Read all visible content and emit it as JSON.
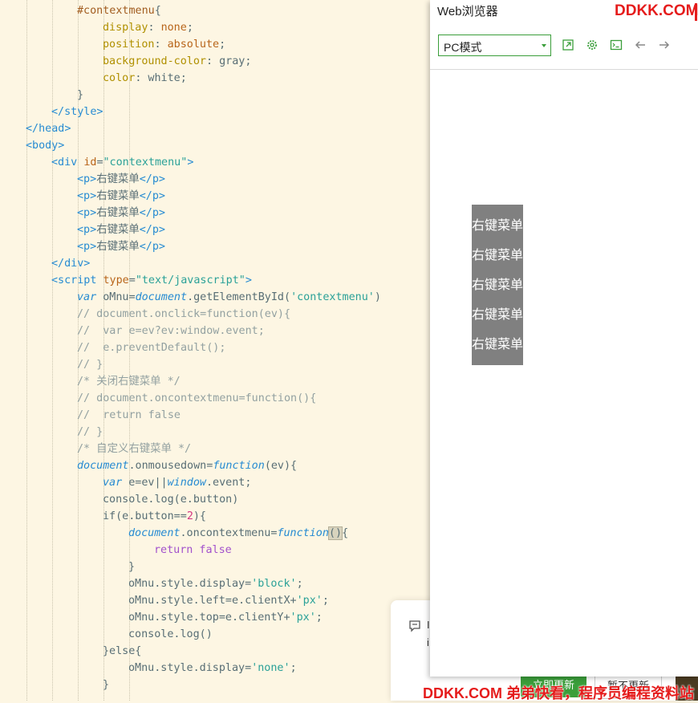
{
  "code": {
    "lines": [
      [
        [
          "tok-sel",
          "#contextmenu"
        ],
        [
          "tok-plain",
          "{"
        ]
      ],
      [
        [
          "tok-prop",
          "display"
        ],
        [
          "tok-plain",
          ": "
        ],
        [
          "tok-val",
          "none"
        ],
        [
          "tok-plain",
          ";"
        ]
      ],
      [
        [
          "tok-prop",
          "position"
        ],
        [
          "tok-plain",
          ": "
        ],
        [
          "tok-val",
          "absolute"
        ],
        [
          "tok-plain",
          ";"
        ]
      ],
      [
        [
          "tok-prop",
          "background-color"
        ],
        [
          "tok-plain",
          ": gray;"
        ]
      ],
      [
        [
          "tok-prop",
          "color"
        ],
        [
          "tok-plain",
          ": white;"
        ]
      ],
      [
        [
          "tok-plain",
          "}"
        ]
      ],
      [
        [
          "tok-tag",
          "</style>"
        ]
      ],
      [
        [
          "tok-tag",
          "</head>"
        ]
      ],
      [
        [
          "tok-tag",
          "<body>"
        ]
      ],
      [
        [
          "tok-tag",
          "<div "
        ],
        [
          "tok-attr",
          "id"
        ],
        [
          "tok-plain",
          "="
        ],
        [
          "tok-str",
          "\"contextmenu\""
        ],
        [
          "tok-tag",
          ">"
        ]
      ],
      [
        [
          "tok-tag",
          "<p>"
        ],
        [
          "tok-plain",
          "右键菜单"
        ],
        [
          "tok-tag",
          "</p>"
        ]
      ],
      [
        [
          "tok-tag",
          "<p>"
        ],
        [
          "tok-plain",
          "右键菜单"
        ],
        [
          "tok-tag",
          "</p>"
        ]
      ],
      [
        [
          "tok-tag",
          "<p>"
        ],
        [
          "tok-plain",
          "右键菜单"
        ],
        [
          "tok-tag",
          "</p>"
        ]
      ],
      [
        [
          "tok-tag",
          "<p>"
        ],
        [
          "tok-plain",
          "右键菜单"
        ],
        [
          "tok-tag",
          "</p>"
        ]
      ],
      [
        [
          "tok-tag",
          "<p>"
        ],
        [
          "tok-plain",
          "右键菜单"
        ],
        [
          "tok-tag",
          "</p>"
        ]
      ],
      [
        [
          "tok-tag",
          "</div>"
        ]
      ],
      [
        [
          "tok-tag",
          "<script "
        ],
        [
          "tok-attr",
          "type"
        ],
        [
          "tok-plain",
          "="
        ],
        [
          "tok-str",
          "\"text/javascript\""
        ],
        [
          "tok-tag",
          ">"
        ]
      ],
      [
        [
          "tok-kw",
          "var "
        ],
        [
          "tok-plain",
          "oMnu="
        ],
        [
          "tok-obj",
          "document"
        ],
        [
          "tok-plain",
          ".getElementById("
        ],
        [
          "tok-str",
          "'contextmenu'"
        ],
        [
          "tok-plain",
          ")"
        ]
      ],
      [
        [
          "tok-com",
          "// document.onclick=function(ev){"
        ]
      ],
      [
        [
          "tok-com",
          "//  var e=ev?ev:window.event;"
        ]
      ],
      [
        [
          "tok-com",
          "//  e.preventDefault();"
        ]
      ],
      [
        [
          "tok-com",
          "// }"
        ]
      ],
      [
        [
          "tok-com",
          "/* 关闭右键菜单 */"
        ]
      ],
      [
        [
          "tok-com",
          "// document.oncontextmenu=function(){"
        ]
      ],
      [
        [
          "tok-com",
          "//  return false"
        ]
      ],
      [
        [
          "tok-com",
          "// }"
        ]
      ],
      [
        [
          "tok-com",
          "/* 自定义右键菜单 */"
        ]
      ],
      [
        [
          "tok-obj",
          "document"
        ],
        [
          "tok-plain",
          ".onmousedown="
        ],
        [
          "tok-kw",
          "function"
        ],
        [
          "tok-plain",
          "(ev){"
        ]
      ],
      [
        [
          "tok-kw",
          "var "
        ],
        [
          "tok-plain",
          "e=ev||"
        ],
        [
          "tok-obj",
          "window"
        ],
        [
          "tok-plain",
          ".event;"
        ]
      ],
      [
        [
          "tok-plain",
          "console.log(e.button)"
        ]
      ],
      [
        [
          "tok-plain",
          "if(e.button=="
        ],
        [
          "tok-num",
          "2"
        ],
        [
          "tok-plain",
          "){"
        ]
      ],
      [
        [
          "tok-obj",
          "document"
        ],
        [
          "tok-plain",
          ".oncontextmenu="
        ],
        [
          "tok-kw",
          "function"
        ],
        [
          "paren-hl",
          "()"
        ],
        [
          "tok-plain",
          "{"
        ]
      ],
      [
        [
          "tok-bool",
          "return false"
        ]
      ],
      [
        [
          "tok-plain",
          "}"
        ]
      ],
      [
        [
          "tok-plain",
          "oMnu.style.display="
        ],
        [
          "tok-str",
          "'block'"
        ],
        [
          "tok-plain",
          ";"
        ]
      ],
      [
        [
          "tok-plain",
          "oMnu.style.left=e.clientX+"
        ],
        [
          "tok-str",
          "'px'"
        ],
        [
          "tok-plain",
          ";"
        ]
      ],
      [
        [
          "tok-plain",
          "oMnu.style.top=e.clientY+"
        ],
        [
          "tok-str",
          "'px'"
        ],
        [
          "tok-plain",
          ";"
        ]
      ],
      [
        [
          "tok-plain",
          "console.log()"
        ]
      ],
      [
        [
          "tok-plain",
          "}else{"
        ]
      ],
      [
        [
          "tok-plain",
          "oMnu.style.display="
        ],
        [
          "tok-str",
          "'none'"
        ],
        [
          "tok-plain",
          ";"
        ]
      ],
      [
        [
          "tok-plain",
          "}"
        ]
      ]
    ]
  },
  "browser": {
    "title": "Web浏览器",
    "mode": "PC模式",
    "toolbar_icons": [
      "open-external-icon",
      "settings-icon",
      "console-icon",
      "back-arrow-icon",
      "forward-arrow-icon"
    ],
    "menu_items": [
      "右键菜单",
      "右键菜单",
      "右键菜单",
      "右键菜单",
      "右键菜单"
    ]
  },
  "notice": {
    "update_label": "立即更新",
    "later_label": "暂不更新"
  },
  "watermark": {
    "top": "DDKK.COM",
    "bottom": "DDKK.COM 弟弟快看，程序员编程资料站"
  },
  "colors": {
    "editor_bg": "#fdf6e3",
    "accent_green": "#3a9e3a",
    "menu_gray": "#808080",
    "watermark_red": "#e51c1c"
  }
}
